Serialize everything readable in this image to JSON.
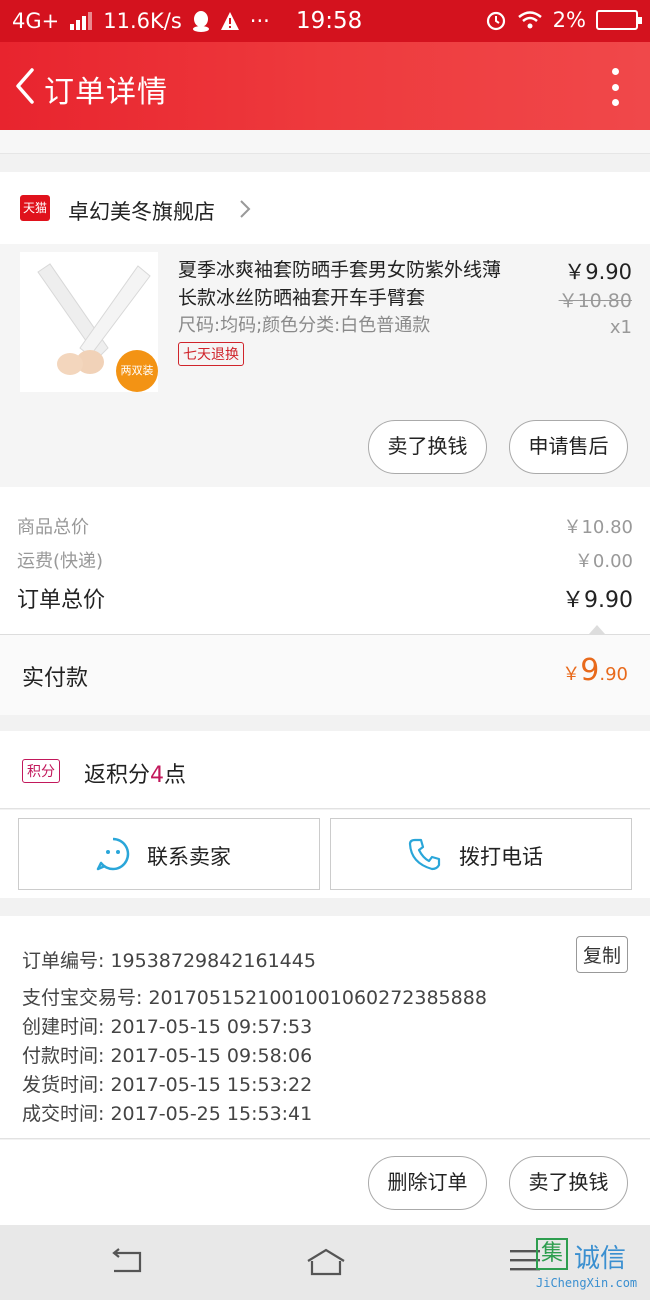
{
  "status_bar": {
    "network": "4G+",
    "speed": "11.6K/s",
    "time": "19:58",
    "battery": "2%"
  },
  "nav": {
    "title": "订单详情"
  },
  "store": {
    "badge": "天猫",
    "name": "卓幻美冬旗舰店"
  },
  "product": {
    "title": "夏季冰爽袖套防晒手套男女防紫外线薄长款冰丝防晒袖套开车手臂套",
    "spec": "尺码:均码;颜色分类:白色普通款",
    "tag": "七天退换",
    "image_badge": "两双装",
    "price": "￥9.90",
    "original_price": "￥10.80",
    "quantity": "x1",
    "btn_sell": "卖了换钱",
    "btn_after_sale": "申请售后"
  },
  "summary": {
    "goods_label": "商品总价",
    "goods_value": "￥10.80",
    "shipping_label": "运费(快递)",
    "shipping_value": "￥0.00",
    "total_label": "订单总价",
    "total_value": "￥9.90",
    "paid_label": "实付款",
    "paid_currency": "￥",
    "paid_int": "9",
    "paid_dec": ".90"
  },
  "points": {
    "tag": "积分",
    "text_before": "返积分",
    "num": "4",
    "text_after": "点"
  },
  "contact": {
    "seller": "联系卖家",
    "phone": "拨打电话"
  },
  "order_info": {
    "order_no": "订单编号: 19538729842161445",
    "alipay_no": "支付宝交易号: 2017051521001001060272385888",
    "created": "创建时间: 2017-05-15 09:57:53",
    "paid": "付款时间: 2017-05-15 09:58:06",
    "shipped": "发货时间: 2017-05-15 15:53:22",
    "completed": "成交时间: 2017-05-25 15:53:41",
    "copy": "复制"
  },
  "actions": {
    "delete": "删除订单",
    "sell": "卖了换钱"
  },
  "watermark": {
    "box": "集",
    "cn": "诚信",
    "en": "JiChengXin.com"
  },
  "colors": {
    "brand_red": "#d4121e",
    "paid_orange": "#e86a1c",
    "points_pink": "#c2185b"
  }
}
